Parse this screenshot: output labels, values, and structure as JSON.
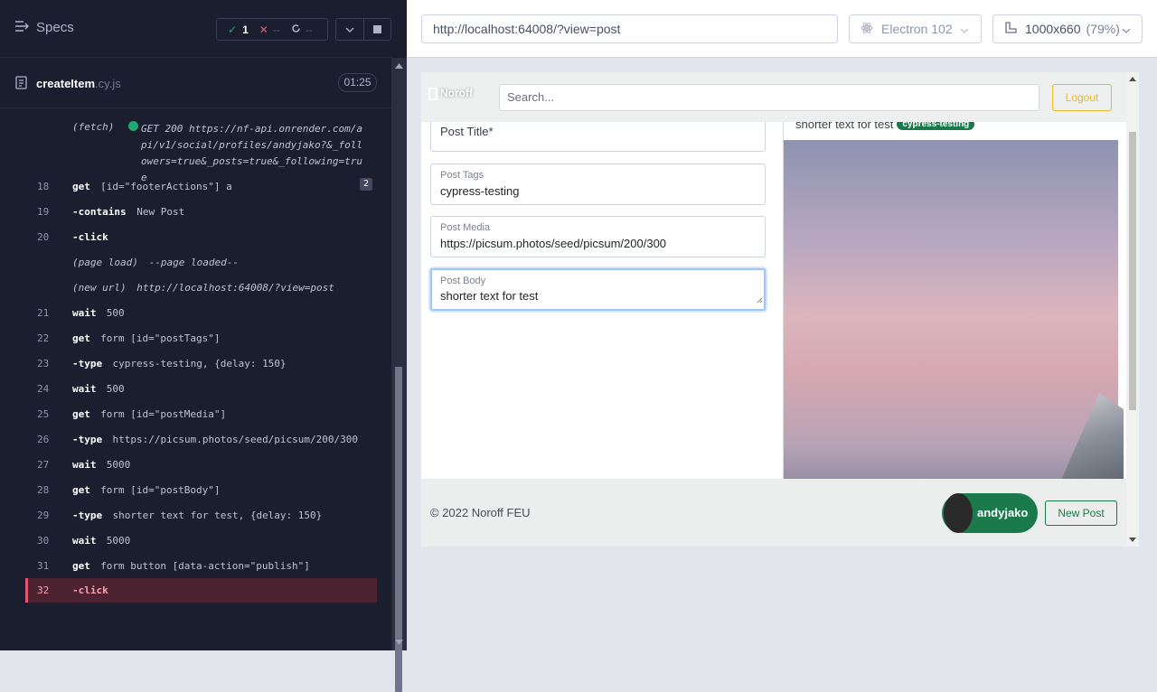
{
  "runner": {
    "specs_label": "Specs",
    "passed": "1",
    "failed": "--",
    "pending": "--"
  },
  "spec": {
    "name": "createItem",
    "ext": ".cy.js",
    "time": "01:25"
  },
  "commands": [
    {
      "line": "",
      "name": "(fetch)",
      "args": "GET 200 https://nf-api.onrender.com/api/v1/social/profiles/andyjako?&_followers=true&_posts=true&_following=true"
    },
    {
      "line": "18",
      "name": "get",
      "args": "[id=\"footerActions\"] a",
      "badge": "2"
    },
    {
      "line": "19",
      "name": "-contains",
      "args": "New Post"
    },
    {
      "line": "20",
      "name": "-click",
      "args": ""
    },
    {
      "line": "",
      "name": "(page load)",
      "args": "--page loaded--"
    },
    {
      "line": "",
      "name": "(new url)",
      "args": "http://localhost:64008/?view=post"
    },
    {
      "line": "21",
      "name": "wait",
      "args": "500"
    },
    {
      "line": "22",
      "name": "get",
      "args": "form [id=\"postTags\"]"
    },
    {
      "line": "23",
      "name": "-type",
      "args": "cypress-testing, {delay: 150}"
    },
    {
      "line": "24",
      "name": "wait",
      "args": "500"
    },
    {
      "line": "25",
      "name": "get",
      "args": "form [id=\"postMedia\"]"
    },
    {
      "line": "26",
      "name": "-type",
      "args": "https://picsum.photos/seed/picsum/200/300"
    },
    {
      "line": "27",
      "name": "wait",
      "args": "5000"
    },
    {
      "line": "28",
      "name": "get",
      "args": "form [id=\"postBody\"]"
    },
    {
      "line": "29",
      "name": "-type",
      "args": "shorter text for test, {delay: 150}"
    },
    {
      "line": "30",
      "name": "wait",
      "args": "5000"
    },
    {
      "line": "31",
      "name": "get",
      "args": "form button [data-action=\"publish\"]"
    },
    {
      "line": "32",
      "name": "-click",
      "args": ""
    }
  ],
  "browser": {
    "url": "http://localhost:64008/?view=post",
    "name": "Electron 102",
    "viewport": "1000x660",
    "zoom": "(79%)"
  },
  "app": {
    "logo": "Noroff",
    "search_placeholder": "Search...",
    "logout": "Logout",
    "form": {
      "title_placeholder": "Post Title*",
      "tags_label": "Post Tags",
      "tags_value": "cypress-testing",
      "media_label": "Post Media",
      "media_value": "https://picsum.photos/seed/picsum/200/300",
      "body_label": "Post Body",
      "body_value": "shorter text for test"
    },
    "preview": {
      "body": "shorter text for test",
      "tag": "cypress-testing"
    },
    "footer": {
      "copyright": "© 2022 Noroff FEU",
      "username": "andyjako",
      "new_post": "New Post"
    }
  }
}
